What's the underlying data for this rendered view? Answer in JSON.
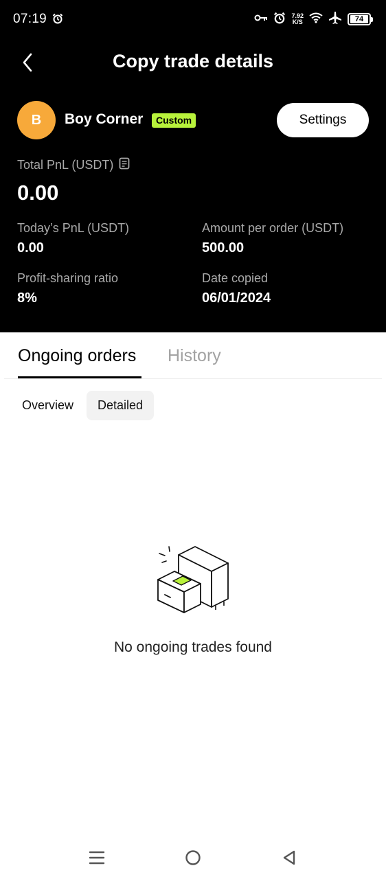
{
  "status_bar": {
    "time": "07:19",
    "net_speed_value": "7.92",
    "net_speed_unit": "K/S",
    "battery": "74"
  },
  "header": {
    "title": "Copy trade details"
  },
  "trader": {
    "avatar_letter": "B",
    "name": "Boy Corner",
    "badge": "Custom",
    "settings_label": "Settings"
  },
  "pnl": {
    "total_label": "Total PnL (USDT)",
    "total_value": "0.00",
    "today_label": "Today’s PnL (USDT)",
    "today_value": "0.00",
    "amount_label": "Amount per order (USDT)",
    "amount_value": "500.00",
    "ratio_label": "Profit-sharing ratio",
    "ratio_value": "8%",
    "date_label": "Date copied",
    "date_value": "06/01/2024"
  },
  "tabs": {
    "ongoing": "Ongoing orders",
    "history": "History",
    "active": "ongoing"
  },
  "segments": {
    "overview": "Overview",
    "detailed": "Detailed",
    "active": "detailed"
  },
  "empty_state": {
    "message": "No ongoing trades found"
  },
  "colors": {
    "accent": "#b8f23b",
    "avatar": "#f7a93a",
    "header_bg": "#000000"
  },
  "icons": [
    "alarm-icon",
    "key-icon",
    "wifi-icon",
    "airplane-icon",
    "battery-icon",
    "back-icon",
    "document-icon",
    "empty-drawer-icon",
    "menu-icon",
    "home-icon",
    "back-triangle-icon"
  ]
}
